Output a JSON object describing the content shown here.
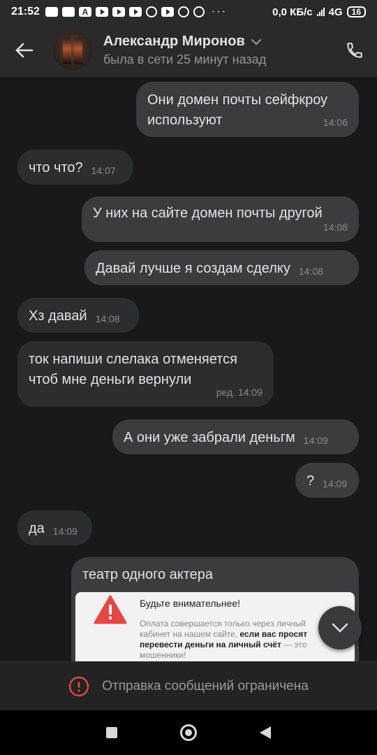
{
  "status_bar": {
    "time": "21:52",
    "dots": "···",
    "network_speed": "0,0 КБ/с",
    "network_type": "4G",
    "battery": "16"
  },
  "header": {
    "contact_name": "Александр Миронов",
    "last_seen": "была в сети 25 минут назад",
    "icons": [
      "back-arrow-icon",
      "chevron-down-icon",
      "phone-icon"
    ]
  },
  "messages": [
    {
      "dir": "out",
      "text": "Они домен почты сейфкроу используют",
      "time": "14:06"
    },
    {
      "dir": "in",
      "text": "что что?",
      "time": "14:07"
    },
    {
      "dir": "out",
      "text": "У них на сайте домен почты другой",
      "time": "14:08"
    },
    {
      "dir": "out",
      "text": "Давай лучше я создам сделку",
      "time": "14:08"
    },
    {
      "dir": "in",
      "text": "Хз давай",
      "time": "14:08"
    },
    {
      "dir": "in",
      "text": "ток напиши слелака отменяется чтоб мне деньги вернули",
      "time": "ред. 14:09"
    },
    {
      "dir": "out",
      "text": "А они уже забрали деньгм",
      "time": "14:09"
    },
    {
      "dir": "out",
      "text": "?",
      "time": "14:09"
    },
    {
      "dir": "in",
      "text": "да",
      "time": "14:09"
    }
  ],
  "forwarded_card": {
    "text": "театр одного актера",
    "warning_title": "Будьте внимательнее!",
    "warning_body_1": "Оплата совершается только через личный кабинет на нашем сайте, ",
    "warning_body_bold": "если вас просят перевести деньги на личный счёт",
    "warning_body_2": " — это мошенники!",
    "warning_color": "#e64646"
  },
  "restriction": {
    "text": "Отправка сообщений ограничена",
    "icon": "alert-circle-icon",
    "color": "#e64646"
  },
  "colors": {
    "background": "#191919",
    "header": "#2a2a2b",
    "bubble_out": "#3c3c3e",
    "bubble_in": "#2c2d2e"
  }
}
